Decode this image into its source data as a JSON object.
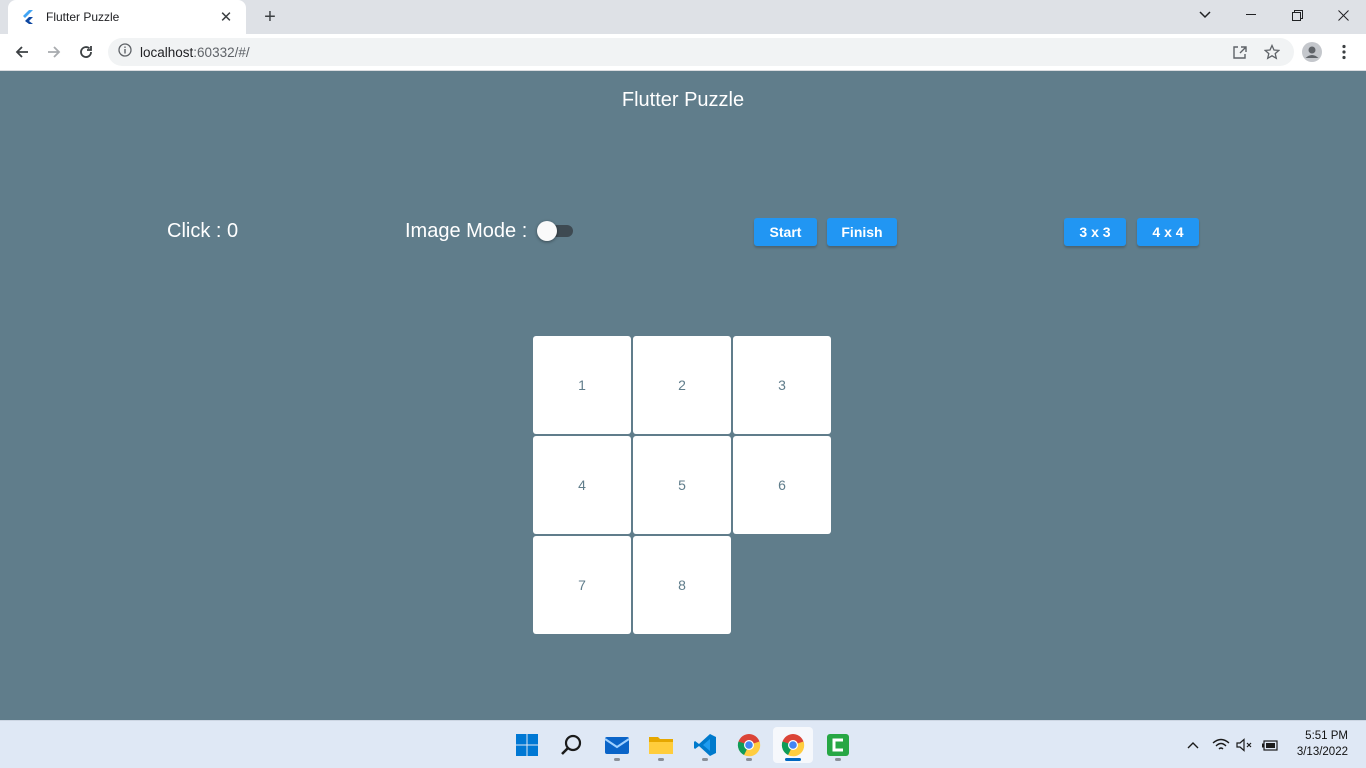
{
  "browser": {
    "tab_title": "Flutter Puzzle",
    "url_host": "localhost",
    "url_rest": ":60332/#/"
  },
  "app": {
    "title": "Flutter Puzzle",
    "click_label": "Click : 0",
    "image_mode_label": "Image Mode :",
    "image_mode_on": false,
    "buttons": {
      "start": "Start",
      "finish": "Finish",
      "size3": "3 x 3",
      "size4": "4 x 4"
    },
    "tiles": [
      "1",
      "2",
      "3",
      "4",
      "5",
      "6",
      "7",
      "8"
    ],
    "colors": {
      "background": "#607d8b",
      "button": "#2196f3",
      "tile": "#ffffff"
    }
  },
  "taskbar": {
    "apps": [
      "start-icon",
      "search-icon",
      "mail-icon",
      "file-explorer-icon",
      "vscode-icon",
      "chrome-icon",
      "chrome-icon",
      "camtasia-icon"
    ],
    "time": "5:51 PM",
    "date": "3/13/2022"
  }
}
